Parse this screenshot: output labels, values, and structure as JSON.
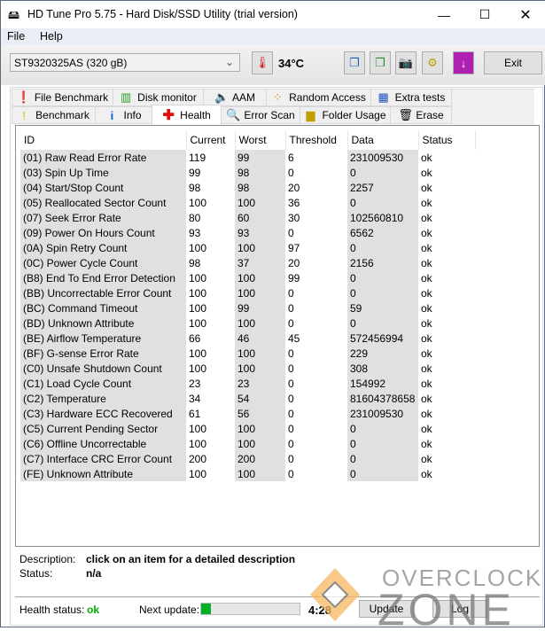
{
  "window": {
    "title": "HD Tune Pro 5.75 - Hard Disk/SSD Utility (trial version)"
  },
  "menu": {
    "file": "File",
    "help": "Help"
  },
  "toolbar": {
    "drive": "ST9320325AS (320 gB)",
    "temperature": "34°C",
    "exit": "Exit"
  },
  "tabs_top": [
    "File Benchmark",
    "Disk monitor",
    "AAM",
    "Random Access",
    "Extra tests"
  ],
  "tabs_bottom": [
    "Benchmark",
    "Info",
    "Health",
    "Error Scan",
    "Folder Usage",
    "Erase"
  ],
  "table": {
    "columns": [
      "ID",
      "Current",
      "Worst",
      "Threshold",
      "Data",
      "Status"
    ],
    "rows": [
      [
        "(01) Raw Read Error Rate",
        "119",
        "99",
        "6",
        "231009530",
        "ok"
      ],
      [
        "(03) Spin Up Time",
        "99",
        "98",
        "0",
        "0",
        "ok"
      ],
      [
        "(04) Start/Stop Count",
        "98",
        "98",
        "20",
        "2257",
        "ok"
      ],
      [
        "(05) Reallocated Sector Count",
        "100",
        "100",
        "36",
        "0",
        "ok"
      ],
      [
        "(07) Seek Error Rate",
        "80",
        "60",
        "30",
        "102560810",
        "ok"
      ],
      [
        "(09) Power On Hours Count",
        "93",
        "93",
        "0",
        "6562",
        "ok"
      ],
      [
        "(0A) Spin Retry Count",
        "100",
        "100",
        "97",
        "0",
        "ok"
      ],
      [
        "(0C) Power Cycle Count",
        "98",
        "37",
        "20",
        "2156",
        "ok"
      ],
      [
        "(B8) End To End Error Detection",
        "100",
        "100",
        "99",
        "0",
        "ok"
      ],
      [
        "(BB) Uncorrectable Error Count",
        "100",
        "100",
        "0",
        "0",
        "ok"
      ],
      [
        "(BC) Command Timeout",
        "100",
        "99",
        "0",
        "59",
        "ok"
      ],
      [
        "(BD) Unknown Attribute",
        "100",
        "100",
        "0",
        "0",
        "ok"
      ],
      [
        "(BE) Airflow Temperature",
        "66",
        "46",
        "45",
        "572456994",
        "ok"
      ],
      [
        "(BF) G-sense Error Rate",
        "100",
        "100",
        "0",
        "229",
        "ok"
      ],
      [
        "(C0) Unsafe Shutdown Count",
        "100",
        "100",
        "0",
        "308",
        "ok"
      ],
      [
        "(C1) Load Cycle Count",
        "23",
        "23",
        "0",
        "154992",
        "ok"
      ],
      [
        "(C2) Temperature",
        "34",
        "54",
        "0",
        "81604378658",
        "ok"
      ],
      [
        "(C3) Hardware ECC Recovered",
        "61",
        "56",
        "0",
        "231009530",
        "ok"
      ],
      [
        "(C5) Current Pending Sector",
        "100",
        "100",
        "0",
        "0",
        "ok"
      ],
      [
        "(C6) Offline Uncorrectable",
        "100",
        "100",
        "0",
        "0",
        "ok"
      ],
      [
        "(C7) Interface CRC Error Count",
        "200",
        "200",
        "0",
        "0",
        "ok"
      ],
      [
        "(FE) Unknown Attribute",
        "100",
        "100",
        "0",
        "0",
        "ok"
      ]
    ]
  },
  "details": {
    "description_label": "Description:",
    "description": "click on an item for a detailed description",
    "status_label": "Status:",
    "status": "n/a"
  },
  "footer": {
    "health_label": "Health status:",
    "health": "ok",
    "next_update_label": "Next update:",
    "progress_percent": 10,
    "countdown": "4:28",
    "update": "Update",
    "log": "Log"
  },
  "watermark": {
    "line1": "OVERCLOCK",
    "line2": "ZONE"
  },
  "colors": {
    "ok": "#00b000",
    "progress": "#06b025"
  }
}
